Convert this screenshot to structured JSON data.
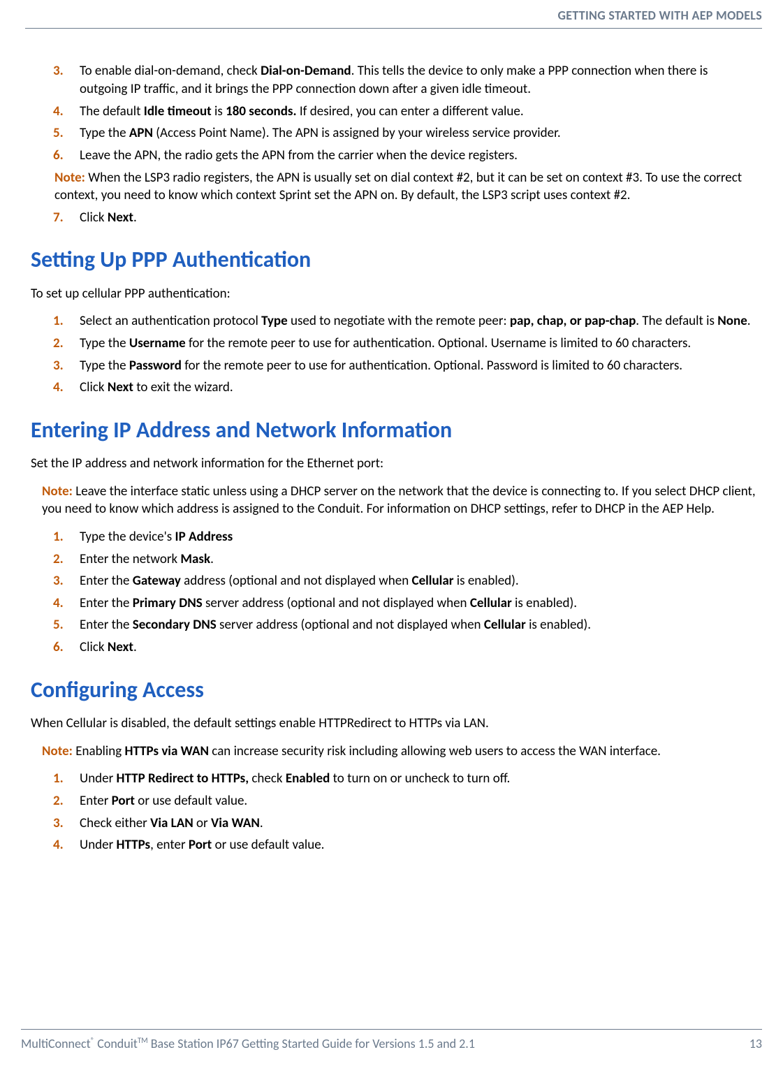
{
  "running_head": "GETTING STARTED WITH AEP MODELS",
  "list1": {
    "i3": {
      "mark": "3.",
      "part1": "To enable dial-on-demand, check ",
      "b1": "Dial-on-Demand",
      "part2": ". This tells the device to only make a PPP connection when there is outgoing IP traffic, and it brings the PPP connection down after a given idle timeout."
    },
    "i4": {
      "mark": "4.",
      "part1": "The default ",
      "b1": "Idle timeout",
      "part2": " is ",
      "b2": "180 seconds.",
      "part3": " If desired, you can enter a different value."
    },
    "i5": {
      "mark": "5.",
      "part1": "Type the ",
      "b1": "APN",
      "part2": " (Access Point Name). The APN is assigned by your wireless service provider."
    },
    "i6": {
      "mark": "6.",
      "text": "Leave the APN, the radio gets the APN from the carrier when the device registers."
    },
    "note": {
      "label": "Note:",
      "text": " When the LSP3 radio registers, the APN is usually set on dial context #2, but it can be set on context #3. To use the correct context, you need to know which context Sprint set the APN on. By default, the LSP3 script uses context #2."
    },
    "i7": {
      "mark": "7.",
      "part1": "Click ",
      "b1": "Next",
      "part2": "."
    }
  },
  "h_ppp": "Setting Up PPP Authentication",
  "lead_ppp": "To set up cellular PPP authentication:",
  "list_ppp": {
    "i1": {
      "mark": "1.",
      "part1": "Select an authentication protocol ",
      "b1": "Type",
      "part2": " used to negotiate with the remote peer: ",
      "b2": "pap, chap, or pap-chap",
      "part3": ". The default is ",
      "b3": "None",
      "part4": "."
    },
    "i2": {
      "mark": "2.",
      "part1": "Type the ",
      "b1": "Username",
      "part2": " for the remote peer to use for authentication. Optional. Username is limited to 60 characters."
    },
    "i3": {
      "mark": "3.",
      "part1": "Type the ",
      "b1": "Password",
      "part2": " for the remote peer to use for authentication. Optional. Password is limited to 60 characters."
    },
    "i4": {
      "mark": "4.",
      "part1": "Click ",
      "b1": "Next",
      "part2": " to exit the wizard."
    }
  },
  "h_ip": "Entering IP Address and Network Information",
  "lead_ip": "Set the IP address and network information for the Ethernet port:",
  "note_ip": {
    "label": "Note:",
    "text": " Leave the interface static unless using a DHCP server on the network that the device is connecting to. If you select DHCP client, you need to know which address is assigned to the Conduit. For information on DHCP settings, refer to DHCP in the AEP Help."
  },
  "list_ip": {
    "i1": {
      "mark": "1.",
      "part1": "Type the device's ",
      "b1": "IP Address"
    },
    "i2": {
      "mark": "2.",
      "part1": "Enter the network ",
      "b1": "Mask",
      "part2": "."
    },
    "i3": {
      "mark": "3.",
      "part1": "Enter the ",
      "b1": "Gateway",
      "part2": " address (optional and not displayed when ",
      "b2": "Cellular",
      "part3": " is enabled)."
    },
    "i4": {
      "mark": "4.",
      "part1": "Enter the ",
      "b1": "Primary DNS",
      "part2": " server address (optional and not displayed when ",
      "b2": "Cellular",
      "part3": " is enabled)."
    },
    "i5": {
      "mark": "5.",
      "part1": "Enter the ",
      "b1": "Secondary DNS",
      "part2": " server address (optional and not displayed when ",
      "b2": "Cellular",
      "part3": " is enabled)."
    },
    "i6": {
      "mark": "6.",
      "part1": "Click ",
      "b1": "Next",
      "part2": "."
    }
  },
  "h_access": "Configuring Access",
  "lead_access": "When Cellular is disabled, the default settings enable HTTPRedirect to HTTPs via LAN.",
  "note_access": {
    "label": "Note:",
    "part1": " Enabling ",
    "b1": "HTTPs via WAN",
    "part2": " can increase security risk including allowing web users to access the WAN interface."
  },
  "list_access": {
    "i1": {
      "mark": "1.",
      "part1": "Under ",
      "b1": "HTTP Redirect to HTTPs,",
      "part2": " check ",
      "b2": "Enabled",
      "part3": " to turn on or uncheck to turn off."
    },
    "i2": {
      "mark": "2.",
      "part1": "Enter ",
      "b1": "Port",
      "part2": " or use default value."
    },
    "i3": {
      "mark": "3.",
      "part1": "Check either ",
      "b1": "Via LAN",
      "part2": " or ",
      "b2": "Via WAN",
      "part3": "."
    },
    "i4": {
      "mark": "4.",
      "part1": "Under ",
      "b1": "HTTPs",
      "part2": ", enter ",
      "b2": "Port",
      "part3": " or use default value."
    }
  },
  "footer": {
    "left_a": "MultiConnect",
    "left_b": " Conduit",
    "left_c": " Base Station IP67 Getting Started Guide for Versions 1.5 and 2.1",
    "page": "13"
  }
}
